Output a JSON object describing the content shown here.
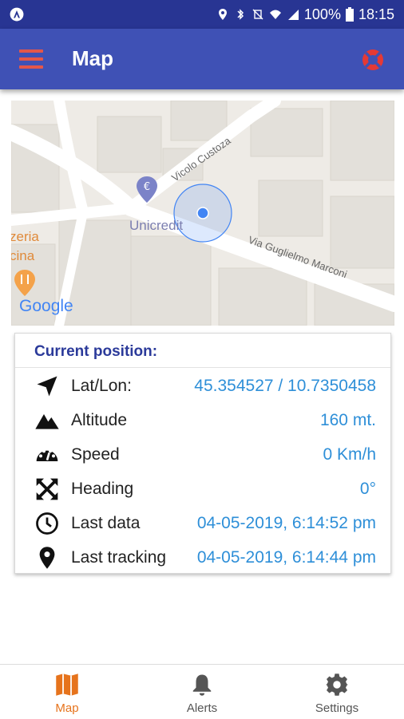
{
  "status_bar": {
    "battery": "100%",
    "time": "18:15"
  },
  "app_bar": {
    "title": "Map"
  },
  "map": {
    "labels": {
      "poi_bank": "Unicredit",
      "street_1": "Vicolo Custoza",
      "street_2": "Via Guglielmo Marconi",
      "poi_partial_1": "zeria",
      "poi_partial_2": "cina",
      "logo": "Google"
    }
  },
  "position_card": {
    "title": "Current position:",
    "rows": [
      {
        "icon": "navigation-arrow-icon",
        "label": "Lat/Lon:",
        "value": "45.354527 / 10.7350458"
      },
      {
        "icon": "mountain-icon",
        "label": "Altitude",
        "value": "160 mt."
      },
      {
        "icon": "speedometer-icon",
        "label": "Speed",
        "value": "0 Km/h"
      },
      {
        "icon": "compass-arrows-icon",
        "label": "Heading",
        "value": "0°"
      },
      {
        "icon": "clock-icon",
        "label": "Last data",
        "value": "04-05-2019, 6:14:52 pm"
      },
      {
        "icon": "location-pin-icon",
        "label": "Last tracking",
        "value": "04-05-2019, 6:14:44 pm"
      }
    ]
  },
  "bottom_nav": {
    "items": [
      {
        "label": "Map",
        "icon": "map-icon",
        "active": true
      },
      {
        "label": "Alerts",
        "icon": "bell-icon",
        "active": false
      },
      {
        "label": "Settings",
        "icon": "gear-icon",
        "active": false
      }
    ]
  },
  "colors": {
    "status_bar": "#283593",
    "app_bar": "#3f51b5",
    "accent": "#e4574a",
    "value_blue": "#2e8fd8",
    "title_blue": "#2b3a9a",
    "nav_active": "#e6731c"
  }
}
